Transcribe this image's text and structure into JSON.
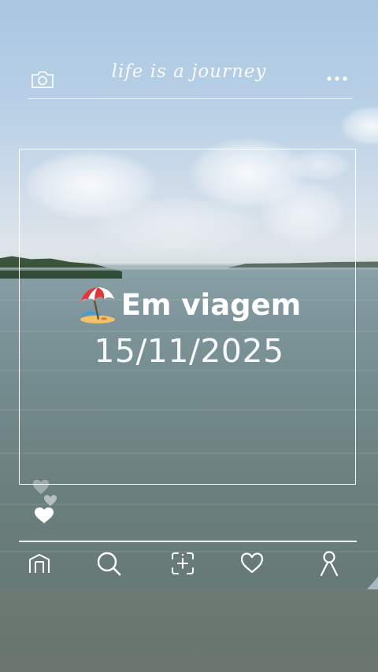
{
  "app": {
    "script_title": "life is a journey"
  },
  "overlay": {
    "headline": "Em viagem",
    "headline_emoji": "beach-umbrella-icon",
    "date": "15/11/2025"
  },
  "topbar": {
    "left_icon": "camera-icon",
    "right_icon": "more-dots-icon"
  },
  "nav": {
    "items": [
      {
        "icon": "home-icon"
      },
      {
        "icon": "search-icon"
      },
      {
        "icon": "add-photo-icon"
      },
      {
        "icon": "heart-icon"
      },
      {
        "icon": "profile-icon"
      }
    ]
  },
  "colors": {
    "overlay_white": "#ffffff",
    "sky": "#b8d0e6",
    "water": "#778e92"
  }
}
